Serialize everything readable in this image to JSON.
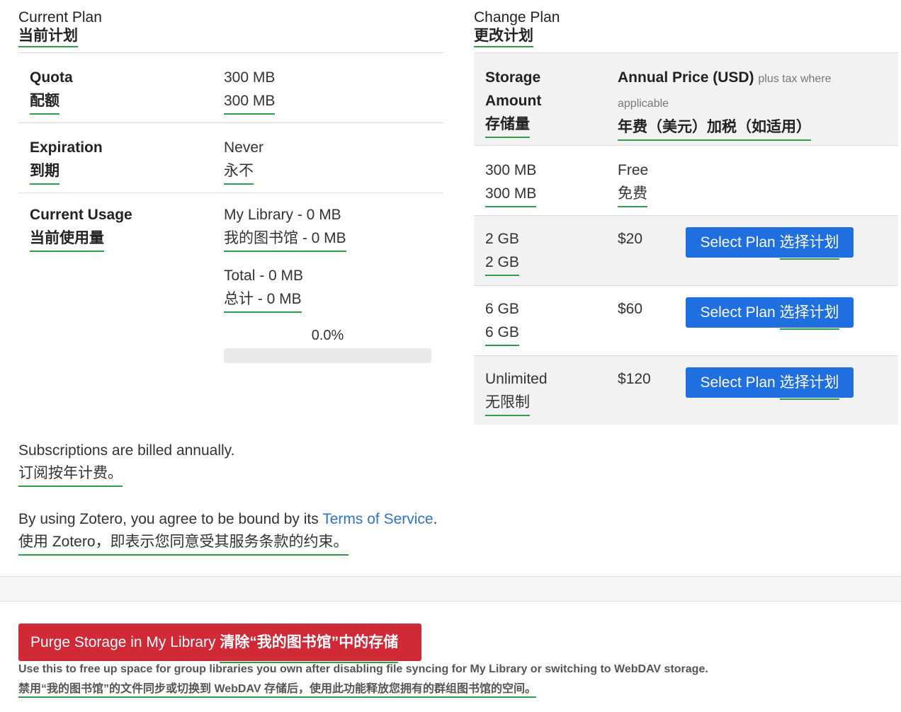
{
  "current_plan": {
    "title": "Current Plan",
    "title_zh": "当前计划",
    "quota": {
      "label": "Quota",
      "label_zh": "配额",
      "value": "300 MB",
      "value_zh": "300 MB"
    },
    "expiration": {
      "label": "Expiration",
      "label_zh": "到期",
      "value": "Never",
      "value_zh": "永不"
    },
    "usage": {
      "label": "Current Usage",
      "label_zh": "当前使用量",
      "library": "My Library - 0 MB",
      "library_zh": "我的图书馆 - 0 MB",
      "total": "Total - 0 MB",
      "total_zh": "总计 - 0 MB",
      "percent_text": "0.0%",
      "percent": 0
    }
  },
  "change_plan": {
    "title": "Change Plan",
    "title_zh": "更改计划",
    "header": {
      "storage": "Storage Amount",
      "storage_zh": "存储量",
      "price": "Annual Price (USD)",
      "price_note": "plus tax where applicable",
      "price_zh": "年费（美元）加税（如适用）"
    },
    "plans": [
      {
        "storage": "300 MB",
        "storage_zh": "300 MB",
        "price": "Free",
        "price_zh": "免费",
        "button": ""
      },
      {
        "storage": "2 GB",
        "storage_zh": "2 GB",
        "price": "$20",
        "price_zh": "",
        "button": "Select Plan",
        "button_zh": "选择计划"
      },
      {
        "storage": "6 GB",
        "storage_zh": "6 GB",
        "price": "$60",
        "price_zh": "",
        "button": "Select Plan",
        "button_zh": "选择计划"
      },
      {
        "storage": "Unlimited",
        "storage_zh": "无限制",
        "price": "$120",
        "price_zh": "",
        "button": "Select Plan",
        "button_zh": "选择计划"
      }
    ]
  },
  "billing": {
    "text": "Subscriptions are billed annually.",
    "text_zh": "订阅按年计费。"
  },
  "terms": {
    "prefix": "By using Zotero, you agree to be bound by its ",
    "link": "Terms of Service",
    "suffix": ".",
    "text_zh": "使用 Zotero，即表示您同意受其服务条款的约束。"
  },
  "purge": {
    "button": "Purge Storage in My Library",
    "button_zh": "清除“我的图书馆”中的存储",
    "help": "Use this to free up space for group libraries you own after disabling file syncing for My Library or switching to WebDAV storage.",
    "help_zh": "禁用“我的图书馆”的文件同步或切换到 WebDAV 存储后，使用此功能释放您拥有的群组图书馆的空间。"
  },
  "colors": {
    "accent": "#1f6fe0",
    "danger": "#cf2a36",
    "translation_underline": "#2e9e4a"
  }
}
